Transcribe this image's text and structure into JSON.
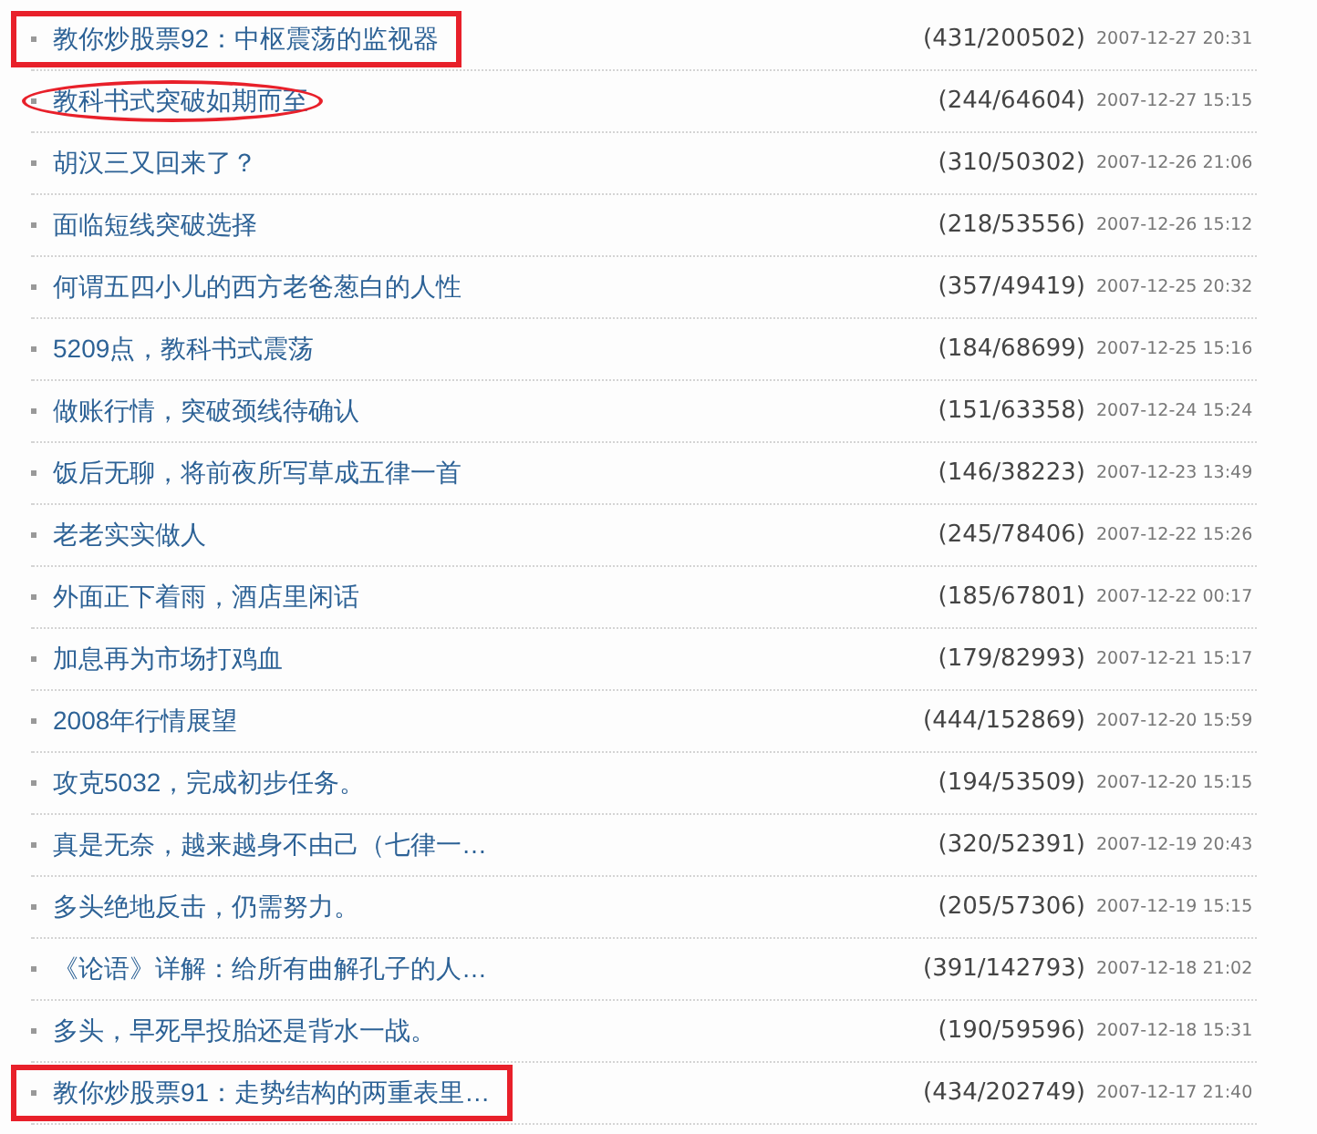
{
  "posts": [
    {
      "title": "教你炒股票92：中枢震荡的监视器",
      "counts": "(431/200502)",
      "date": "2007-12-27 20:31",
      "framed": true,
      "circled": false
    },
    {
      "title": "教科书式突破如期而至",
      "counts": "(244/64604)",
      "date": "2007-12-27 15:15",
      "framed": false,
      "circled": true
    },
    {
      "title": "胡汉三又回来了？",
      "counts": "(310/50302)",
      "date": "2007-12-26 21:06",
      "framed": false,
      "circled": false
    },
    {
      "title": "面临短线突破选择",
      "counts": "(218/53556)",
      "date": "2007-12-26 15:12",
      "framed": false,
      "circled": false
    },
    {
      "title": "何谓五四小儿的西方老爸葱白的人性",
      "counts": "(357/49419)",
      "date": "2007-12-25 20:32",
      "framed": false,
      "circled": false
    },
    {
      "title": "5209点，教科书式震荡",
      "counts": "(184/68699)",
      "date": "2007-12-25 15:16",
      "framed": false,
      "circled": false
    },
    {
      "title": "做账行情，突破颈线待确认",
      "counts": "(151/63358)",
      "date": "2007-12-24 15:24",
      "framed": false,
      "circled": false
    },
    {
      "title": "饭后无聊，将前夜所写草成五律一首",
      "counts": "(146/38223)",
      "date": "2007-12-23 13:49",
      "framed": false,
      "circled": false
    },
    {
      "title": "老老实实做人",
      "counts": "(245/78406)",
      "date": "2007-12-22 15:26",
      "framed": false,
      "circled": false
    },
    {
      "title": "外面正下着雨，酒店里闲话",
      "counts": "(185/67801)",
      "date": "2007-12-22 00:17",
      "framed": false,
      "circled": false
    },
    {
      "title": "加息再为市场打鸡血",
      "counts": "(179/82993)",
      "date": "2007-12-21 15:17",
      "framed": false,
      "circled": false
    },
    {
      "title": "2008年行情展望",
      "counts": "(444/152869)",
      "date": "2007-12-20 15:59",
      "framed": false,
      "circled": false
    },
    {
      "title": "攻克5032，完成初步任务。",
      "counts": "(194/53509)",
      "date": "2007-12-20 15:15",
      "framed": false,
      "circled": false
    },
    {
      "title": "真是无奈，越来越身不由己（七律一…",
      "counts": "(320/52391)",
      "date": "2007-12-19 20:43",
      "framed": false,
      "circled": false
    },
    {
      "title": "多头绝地反击，仍需努力。",
      "counts": "(205/57306)",
      "date": "2007-12-19 15:15",
      "framed": false,
      "circled": false
    },
    {
      "title": "《论语》详解：给所有曲解孔子的人…",
      "counts": "(391/142793)",
      "date": "2007-12-18 21:02",
      "framed": false,
      "circled": false
    },
    {
      "title": "多头，早死早投胎还是背水一战。",
      "counts": "(190/59596)",
      "date": "2007-12-18 15:31",
      "framed": false,
      "circled": false
    },
    {
      "title": "教你炒股票91：走势结构的两重表里…",
      "counts": "(434/202749)",
      "date": "2007-12-17 21:40",
      "framed": true,
      "circled": false
    }
  ]
}
